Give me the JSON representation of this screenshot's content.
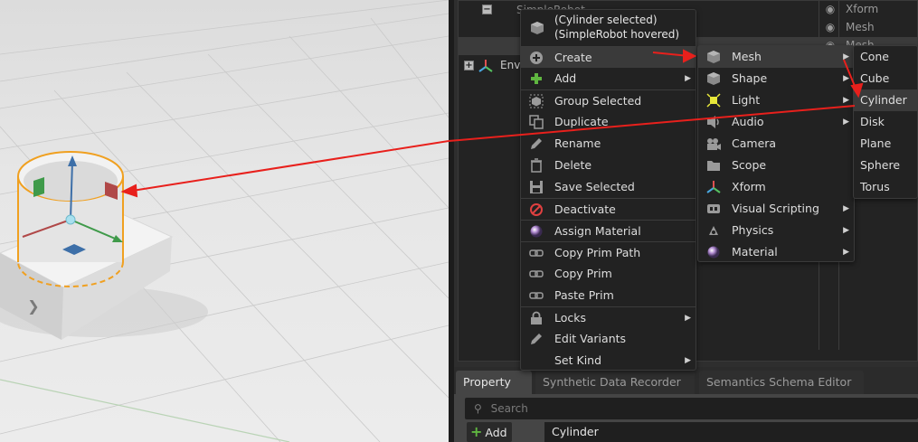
{
  "stage": {
    "rows": [
      {
        "label": "SimpleRobot",
        "type": "Xform"
      },
      {
        "label": "",
        "type": "Mesh"
      },
      {
        "label": "",
        "type": "Mesh"
      },
      {
        "label": "Envi",
        "type": ""
      }
    ]
  },
  "context_menu": {
    "header_line1": "(Cylinder selected)",
    "header_line2": "(SimpleRobot hovered)",
    "items": [
      {
        "label": "Create",
        "icon": "plus-circle-icon",
        "submenu": true
      },
      {
        "label": "Add",
        "icon": "green-plus-icon",
        "submenu": true
      },
      {
        "label": "Group Selected",
        "icon": "group-icon",
        "submenu": false
      },
      {
        "label": "Duplicate",
        "icon": "duplicate-icon",
        "submenu": false
      },
      {
        "label": "Rename",
        "icon": "pencil-icon",
        "submenu": false
      },
      {
        "label": "Delete",
        "icon": "trash-icon",
        "submenu": false
      },
      {
        "label": "Save Selected",
        "icon": "save-icon",
        "submenu": false
      },
      {
        "label": "Deactivate",
        "icon": "deactivate-icon",
        "submenu": false
      },
      {
        "label": "Assign Material",
        "icon": "material-sphere-icon",
        "submenu": false
      },
      {
        "label": "Copy Prim Path",
        "icon": "link-icon",
        "submenu": false
      },
      {
        "label": "Copy Prim",
        "icon": "link-icon",
        "submenu": false
      },
      {
        "label": "Paste Prim",
        "icon": "link-icon",
        "submenu": false
      },
      {
        "label": "Locks",
        "icon": "lock-icon",
        "submenu": true
      },
      {
        "label": "Edit Variants",
        "icon": "pencil-icon",
        "submenu": false
      },
      {
        "label": "Set Kind",
        "icon": "",
        "submenu": true
      }
    ]
  },
  "create_submenu": {
    "items": [
      {
        "label": "Mesh",
        "icon": "cube-icon",
        "submenu": true
      },
      {
        "label": "Shape",
        "icon": "cube-icon",
        "submenu": true
      },
      {
        "label": "Light",
        "icon": "light-icon",
        "submenu": true
      },
      {
        "label": "Audio",
        "icon": "speaker-icon",
        "submenu": true
      },
      {
        "label": "Camera",
        "icon": "camera-icon",
        "submenu": false
      },
      {
        "label": "Scope",
        "icon": "folder-icon",
        "submenu": false
      },
      {
        "label": "Xform",
        "icon": "xform-axes-icon",
        "submenu": false
      },
      {
        "label": "Visual Scripting",
        "icon": "graph-icon",
        "submenu": true
      },
      {
        "label": "Physics",
        "icon": "physics-icon",
        "submenu": true
      },
      {
        "label": "Material",
        "icon": "material-sphere-icon",
        "submenu": true
      }
    ]
  },
  "mesh_submenu": {
    "items": [
      "Cone",
      "Cube",
      "Cylinder",
      "Disk",
      "Plane",
      "Sphere",
      "Torus"
    ]
  },
  "property_panel": {
    "tabs": [
      "Property",
      "Synthetic Data Recorder",
      "Semantics Schema Editor"
    ],
    "search_placeholder": "Search",
    "add_label": "Add",
    "prim_name": "Cylinder"
  },
  "colors": {
    "annotation_arrow": "#e8201c",
    "selection_outline": "#f0a020"
  }
}
